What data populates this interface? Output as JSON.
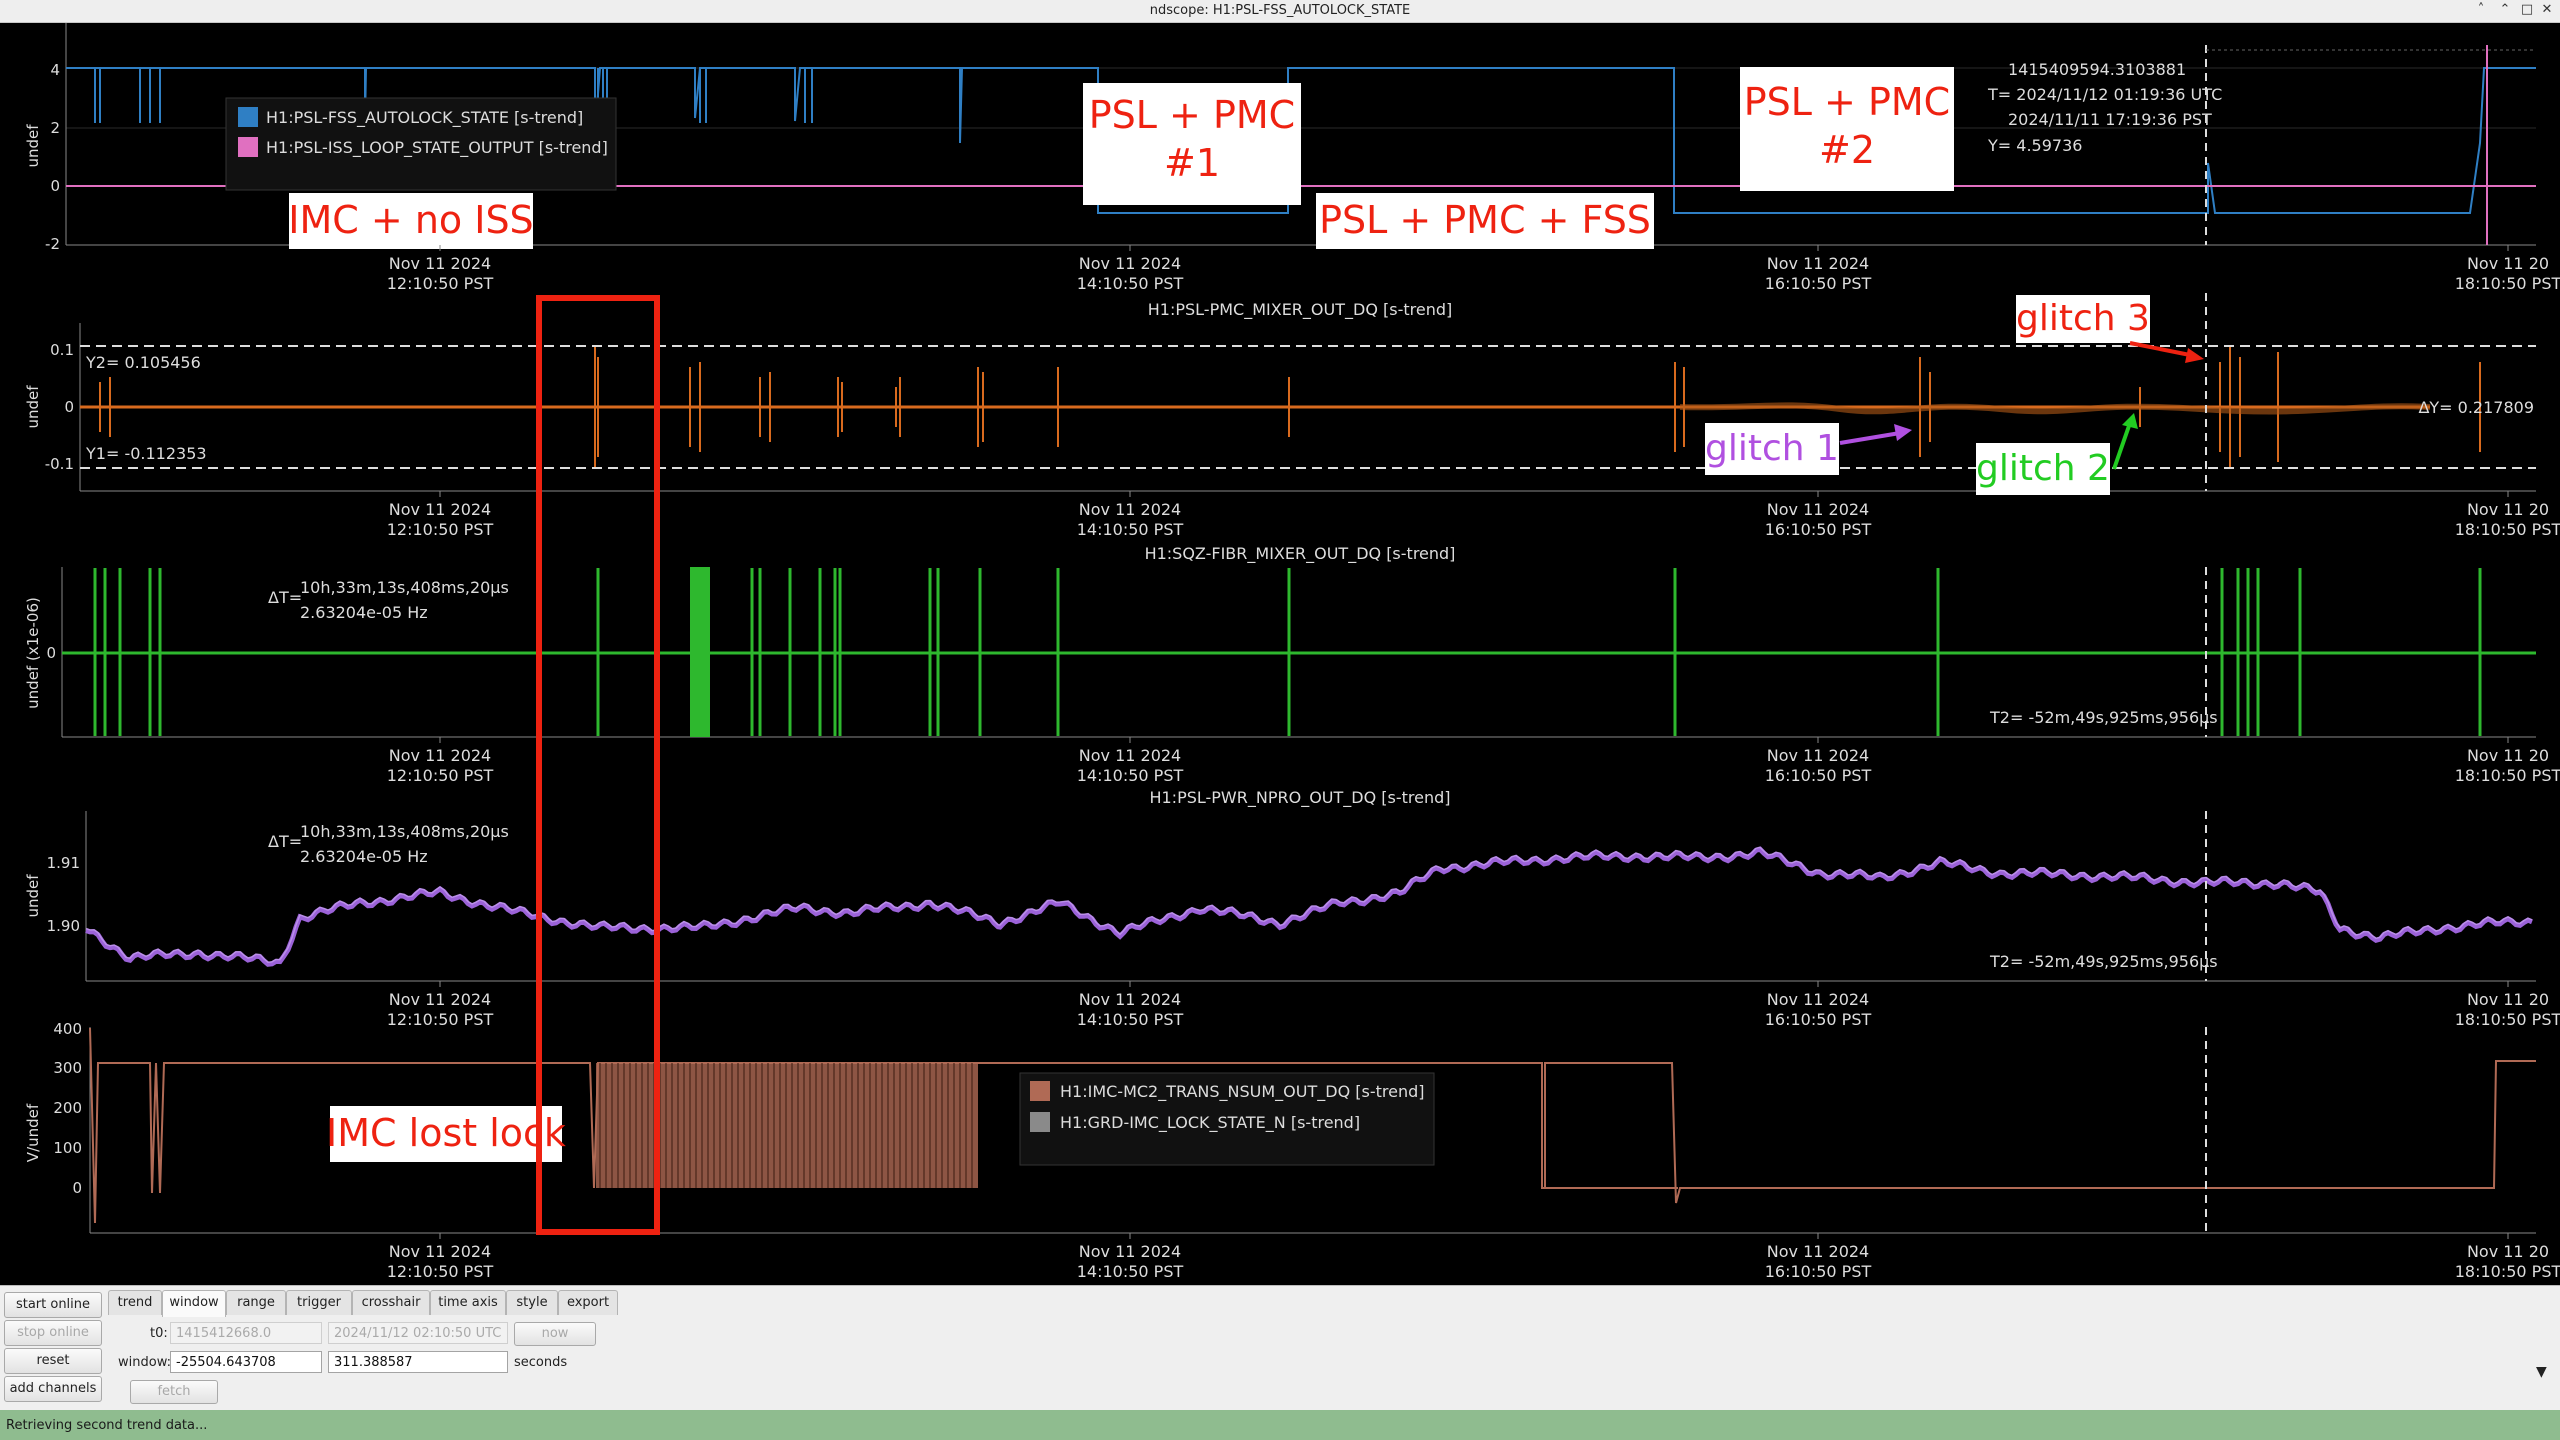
{
  "window": {
    "title": "ndscope: H1:PSL-FSS_AUTOLOCK_STATE"
  },
  "colors": {
    "blue": "#2f7fc4",
    "pink": "#e070c0",
    "orange": "#d86a1e",
    "green": "#2eb82e",
    "purple": "#9b62d8",
    "brown": "#b06a55",
    "gray": "#8a8a8a",
    "annotation_red": "#ee2211",
    "status_green": "#8fbc8f"
  },
  "xaxis": {
    "date": "Nov 11 2024",
    "date_right": "Nov 11 20",
    "times": [
      "12:10:50 PST",
      "14:10:50 PST",
      "16:10:50 PST",
      "18:10:50 PST"
    ]
  },
  "plot1": {
    "ylabel": "undef",
    "yticks": [
      "4",
      "2",
      "0",
      "-2"
    ],
    "legend": [
      "H1:PSL-FSS_AUTOLOCK_STATE [s-trend]",
      "H1:PSL-ISS_LOOP_STATE_OUTPUT [s-trend]"
    ],
    "cursor": {
      "gps": "1415409594.3103881",
      "utc": "T= 2024/11/12 01:19:36 UTC",
      "pst": "2024/11/11 17:19:36 PST",
      "y": "Y= 4.59736"
    },
    "annotations": {
      "imc_no_iss": "IMC + no ISS",
      "pmc1_line1": "PSL + PMC",
      "pmc1_line2": "#1",
      "pmc_fss": "PSL + PMC + FSS",
      "pmc2_line1": "PSL + PMC",
      "pmc2_line2": "#2"
    }
  },
  "plot2": {
    "title": "H1:PSL-PMC_MIXER_OUT_DQ [s-trend]",
    "ylabel": "undef",
    "yticks": [
      "0.1",
      "0",
      "-0.1"
    ],
    "y2": "Y2= 0.105456",
    "y1": "Y1= -0.112353",
    "dy": "ΔY= 0.217809",
    "annotations": {
      "glitch1": "glitch 1",
      "glitch2": "glitch 2",
      "glitch3": "glitch 3"
    }
  },
  "plot3": {
    "title": "H1:SQZ-FIBR_MIXER_OUT_DQ [s-trend]",
    "ylabel": "undef (x1e-06)",
    "yticks": [
      "0"
    ],
    "dt_label": "ΔT=",
    "dt": "10h,33m,13s,408ms,20μs",
    "freq": "2.63204e-05 Hz",
    "t2": "T2= -52m,49s,925ms,956μs"
  },
  "plot4": {
    "title": "H1:PSL-PWR_NPRO_OUT_DQ [s-trend]",
    "ylabel": "undef",
    "yticks": [
      "1.91",
      "1.90"
    ],
    "dt_label": "ΔT=",
    "dt": "10h,33m,13s,408ms,20μs",
    "freq": "2.63204e-05 Hz",
    "t2": "T2= -52m,49s,925ms,956μs"
  },
  "plot5": {
    "ylabel": "V/undef",
    "yticks": [
      "400",
      "300",
      "200",
      "100",
      "0"
    ],
    "legend": [
      "H1:IMC-MC2_TRANS_NSUM_OUT_DQ [s-trend]",
      "H1:GRD-IMC_LOCK_STATE_N [s-trend]"
    ],
    "annotations": {
      "imc_lost_lock": "IMC lost lock"
    }
  },
  "controls": {
    "start_online": "start online",
    "stop_online": "stop online",
    "reset": "reset",
    "add_channels": "add channels",
    "fetch": "fetch",
    "now": "now",
    "tabs": [
      "trend",
      "window",
      "range",
      "trigger",
      "crosshair",
      "time axis",
      "style",
      "export"
    ],
    "active_tab": "window",
    "t0_label": "t0:",
    "t0_gps": "1415412668.0",
    "t0_utc": "2024/11/12 02:10:50 UTC",
    "window_label": "window:",
    "window_start": "-25504.643708",
    "window_end": "311.388587",
    "seconds_label": "seconds"
  },
  "status": {
    "message": "Retrieving second trend data..."
  }
}
